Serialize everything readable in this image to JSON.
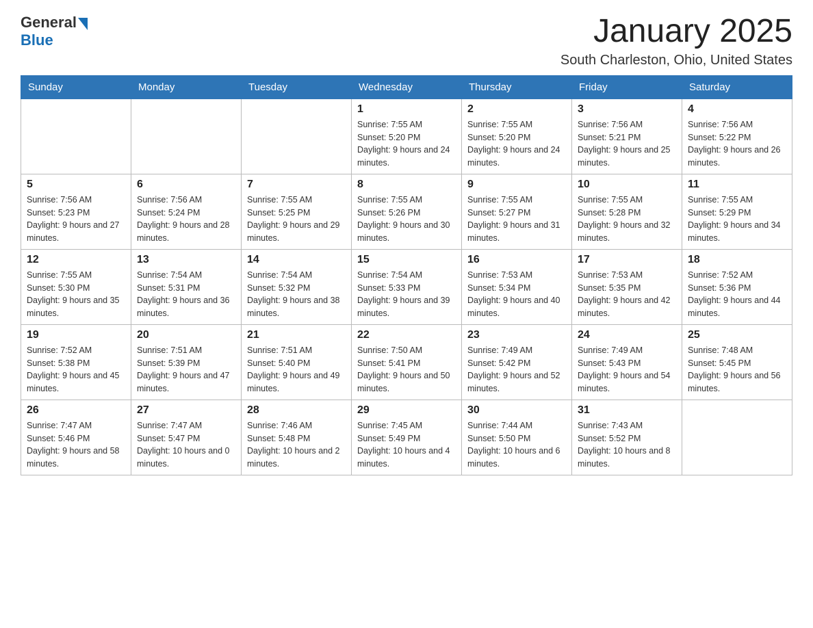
{
  "header": {
    "logo_general": "General",
    "logo_blue": "Blue",
    "title": "January 2025",
    "subtitle": "South Charleston, Ohio, United States"
  },
  "weekdays": [
    "Sunday",
    "Monday",
    "Tuesday",
    "Wednesday",
    "Thursday",
    "Friday",
    "Saturday"
  ],
  "weeks": [
    [
      {
        "day": "",
        "sunrise": "",
        "sunset": "",
        "daylight": ""
      },
      {
        "day": "",
        "sunrise": "",
        "sunset": "",
        "daylight": ""
      },
      {
        "day": "",
        "sunrise": "",
        "sunset": "",
        "daylight": ""
      },
      {
        "day": "1",
        "sunrise": "Sunrise: 7:55 AM",
        "sunset": "Sunset: 5:20 PM",
        "daylight": "Daylight: 9 hours and 24 minutes."
      },
      {
        "day": "2",
        "sunrise": "Sunrise: 7:55 AM",
        "sunset": "Sunset: 5:20 PM",
        "daylight": "Daylight: 9 hours and 24 minutes."
      },
      {
        "day": "3",
        "sunrise": "Sunrise: 7:56 AM",
        "sunset": "Sunset: 5:21 PM",
        "daylight": "Daylight: 9 hours and 25 minutes."
      },
      {
        "day": "4",
        "sunrise": "Sunrise: 7:56 AM",
        "sunset": "Sunset: 5:22 PM",
        "daylight": "Daylight: 9 hours and 26 minutes."
      }
    ],
    [
      {
        "day": "5",
        "sunrise": "Sunrise: 7:56 AM",
        "sunset": "Sunset: 5:23 PM",
        "daylight": "Daylight: 9 hours and 27 minutes."
      },
      {
        "day": "6",
        "sunrise": "Sunrise: 7:56 AM",
        "sunset": "Sunset: 5:24 PM",
        "daylight": "Daylight: 9 hours and 28 minutes."
      },
      {
        "day": "7",
        "sunrise": "Sunrise: 7:55 AM",
        "sunset": "Sunset: 5:25 PM",
        "daylight": "Daylight: 9 hours and 29 minutes."
      },
      {
        "day": "8",
        "sunrise": "Sunrise: 7:55 AM",
        "sunset": "Sunset: 5:26 PM",
        "daylight": "Daylight: 9 hours and 30 minutes."
      },
      {
        "day": "9",
        "sunrise": "Sunrise: 7:55 AM",
        "sunset": "Sunset: 5:27 PM",
        "daylight": "Daylight: 9 hours and 31 minutes."
      },
      {
        "day": "10",
        "sunrise": "Sunrise: 7:55 AM",
        "sunset": "Sunset: 5:28 PM",
        "daylight": "Daylight: 9 hours and 32 minutes."
      },
      {
        "day": "11",
        "sunrise": "Sunrise: 7:55 AM",
        "sunset": "Sunset: 5:29 PM",
        "daylight": "Daylight: 9 hours and 34 minutes."
      }
    ],
    [
      {
        "day": "12",
        "sunrise": "Sunrise: 7:55 AM",
        "sunset": "Sunset: 5:30 PM",
        "daylight": "Daylight: 9 hours and 35 minutes."
      },
      {
        "day": "13",
        "sunrise": "Sunrise: 7:54 AM",
        "sunset": "Sunset: 5:31 PM",
        "daylight": "Daylight: 9 hours and 36 minutes."
      },
      {
        "day": "14",
        "sunrise": "Sunrise: 7:54 AM",
        "sunset": "Sunset: 5:32 PM",
        "daylight": "Daylight: 9 hours and 38 minutes."
      },
      {
        "day": "15",
        "sunrise": "Sunrise: 7:54 AM",
        "sunset": "Sunset: 5:33 PM",
        "daylight": "Daylight: 9 hours and 39 minutes."
      },
      {
        "day": "16",
        "sunrise": "Sunrise: 7:53 AM",
        "sunset": "Sunset: 5:34 PM",
        "daylight": "Daylight: 9 hours and 40 minutes."
      },
      {
        "day": "17",
        "sunrise": "Sunrise: 7:53 AM",
        "sunset": "Sunset: 5:35 PM",
        "daylight": "Daylight: 9 hours and 42 minutes."
      },
      {
        "day": "18",
        "sunrise": "Sunrise: 7:52 AM",
        "sunset": "Sunset: 5:36 PM",
        "daylight": "Daylight: 9 hours and 44 minutes."
      }
    ],
    [
      {
        "day": "19",
        "sunrise": "Sunrise: 7:52 AM",
        "sunset": "Sunset: 5:38 PM",
        "daylight": "Daylight: 9 hours and 45 minutes."
      },
      {
        "day": "20",
        "sunrise": "Sunrise: 7:51 AM",
        "sunset": "Sunset: 5:39 PM",
        "daylight": "Daylight: 9 hours and 47 minutes."
      },
      {
        "day": "21",
        "sunrise": "Sunrise: 7:51 AM",
        "sunset": "Sunset: 5:40 PM",
        "daylight": "Daylight: 9 hours and 49 minutes."
      },
      {
        "day": "22",
        "sunrise": "Sunrise: 7:50 AM",
        "sunset": "Sunset: 5:41 PM",
        "daylight": "Daylight: 9 hours and 50 minutes."
      },
      {
        "day": "23",
        "sunrise": "Sunrise: 7:49 AM",
        "sunset": "Sunset: 5:42 PM",
        "daylight": "Daylight: 9 hours and 52 minutes."
      },
      {
        "day": "24",
        "sunrise": "Sunrise: 7:49 AM",
        "sunset": "Sunset: 5:43 PM",
        "daylight": "Daylight: 9 hours and 54 minutes."
      },
      {
        "day": "25",
        "sunrise": "Sunrise: 7:48 AM",
        "sunset": "Sunset: 5:45 PM",
        "daylight": "Daylight: 9 hours and 56 minutes."
      }
    ],
    [
      {
        "day": "26",
        "sunrise": "Sunrise: 7:47 AM",
        "sunset": "Sunset: 5:46 PM",
        "daylight": "Daylight: 9 hours and 58 minutes."
      },
      {
        "day": "27",
        "sunrise": "Sunrise: 7:47 AM",
        "sunset": "Sunset: 5:47 PM",
        "daylight": "Daylight: 10 hours and 0 minutes."
      },
      {
        "day": "28",
        "sunrise": "Sunrise: 7:46 AM",
        "sunset": "Sunset: 5:48 PM",
        "daylight": "Daylight: 10 hours and 2 minutes."
      },
      {
        "day": "29",
        "sunrise": "Sunrise: 7:45 AM",
        "sunset": "Sunset: 5:49 PM",
        "daylight": "Daylight: 10 hours and 4 minutes."
      },
      {
        "day": "30",
        "sunrise": "Sunrise: 7:44 AM",
        "sunset": "Sunset: 5:50 PM",
        "daylight": "Daylight: 10 hours and 6 minutes."
      },
      {
        "day": "31",
        "sunrise": "Sunrise: 7:43 AM",
        "sunset": "Sunset: 5:52 PM",
        "daylight": "Daylight: 10 hours and 8 minutes."
      },
      {
        "day": "",
        "sunrise": "",
        "sunset": "",
        "daylight": ""
      }
    ]
  ]
}
